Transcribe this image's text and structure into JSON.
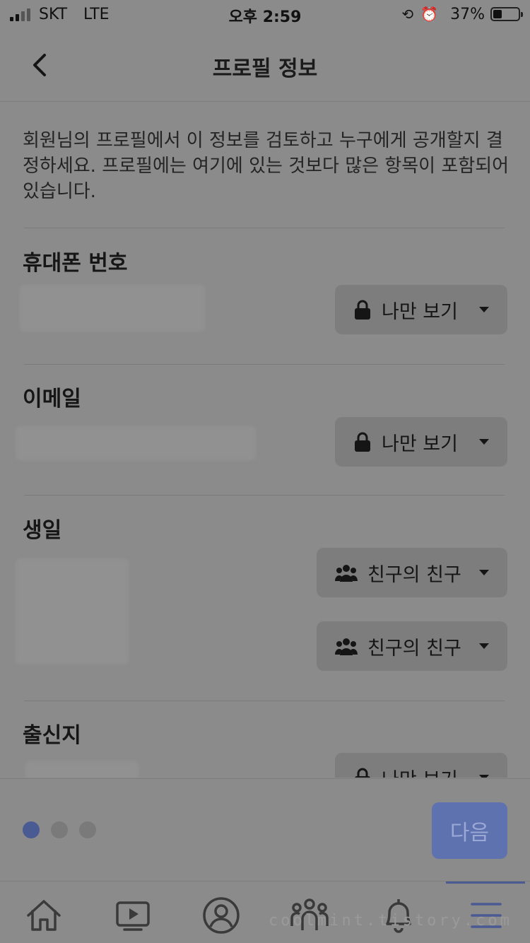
{
  "status_bar": {
    "carrier": "SKT",
    "network": "LTE",
    "time": "오후 2:59",
    "battery_percent": "37%",
    "battery_level": 0.37
  },
  "header": {
    "title": "프로필 정보",
    "back_icon": "chevron-left-icon"
  },
  "intro_text": "회원님의 프로필에서 이 정보를 검토하고 누구에게 공개할지 결정하세요. 프로필에는 여기에 있는 것보다 많은 항목이 포함되어 있습니다.",
  "sections": [
    {
      "title": "휴대폰 번호",
      "privacy": [
        "나만 보기"
      ],
      "privacy_icons": [
        "lock-icon"
      ]
    },
    {
      "title": "이메일",
      "privacy": [
        "나만 보기"
      ],
      "privacy_icons": [
        "lock-icon"
      ]
    },
    {
      "title": "생일",
      "privacy": [
        "친구의 친구",
        "친구의 친구"
      ],
      "privacy_icons": [
        "people-icon",
        "people-icon"
      ]
    },
    {
      "title": "출신지",
      "privacy": [
        "나만 보기"
      ],
      "privacy_icons": [
        "lock-icon"
      ]
    }
  ],
  "pagination": {
    "pages": 3,
    "current": 1
  },
  "next_button": "다음",
  "tabs": [
    "home-icon",
    "video-icon",
    "profile-icon",
    "groups-icon",
    "notification-icon",
    "menu-icon"
  ],
  "active_tab": "menu-icon",
  "watermark": "coolmint.tistory.com",
  "colors": {
    "accent": "#4a5a92",
    "button_bg": "#7d7d7d",
    "overlay_bg": "#8b8b8b"
  }
}
